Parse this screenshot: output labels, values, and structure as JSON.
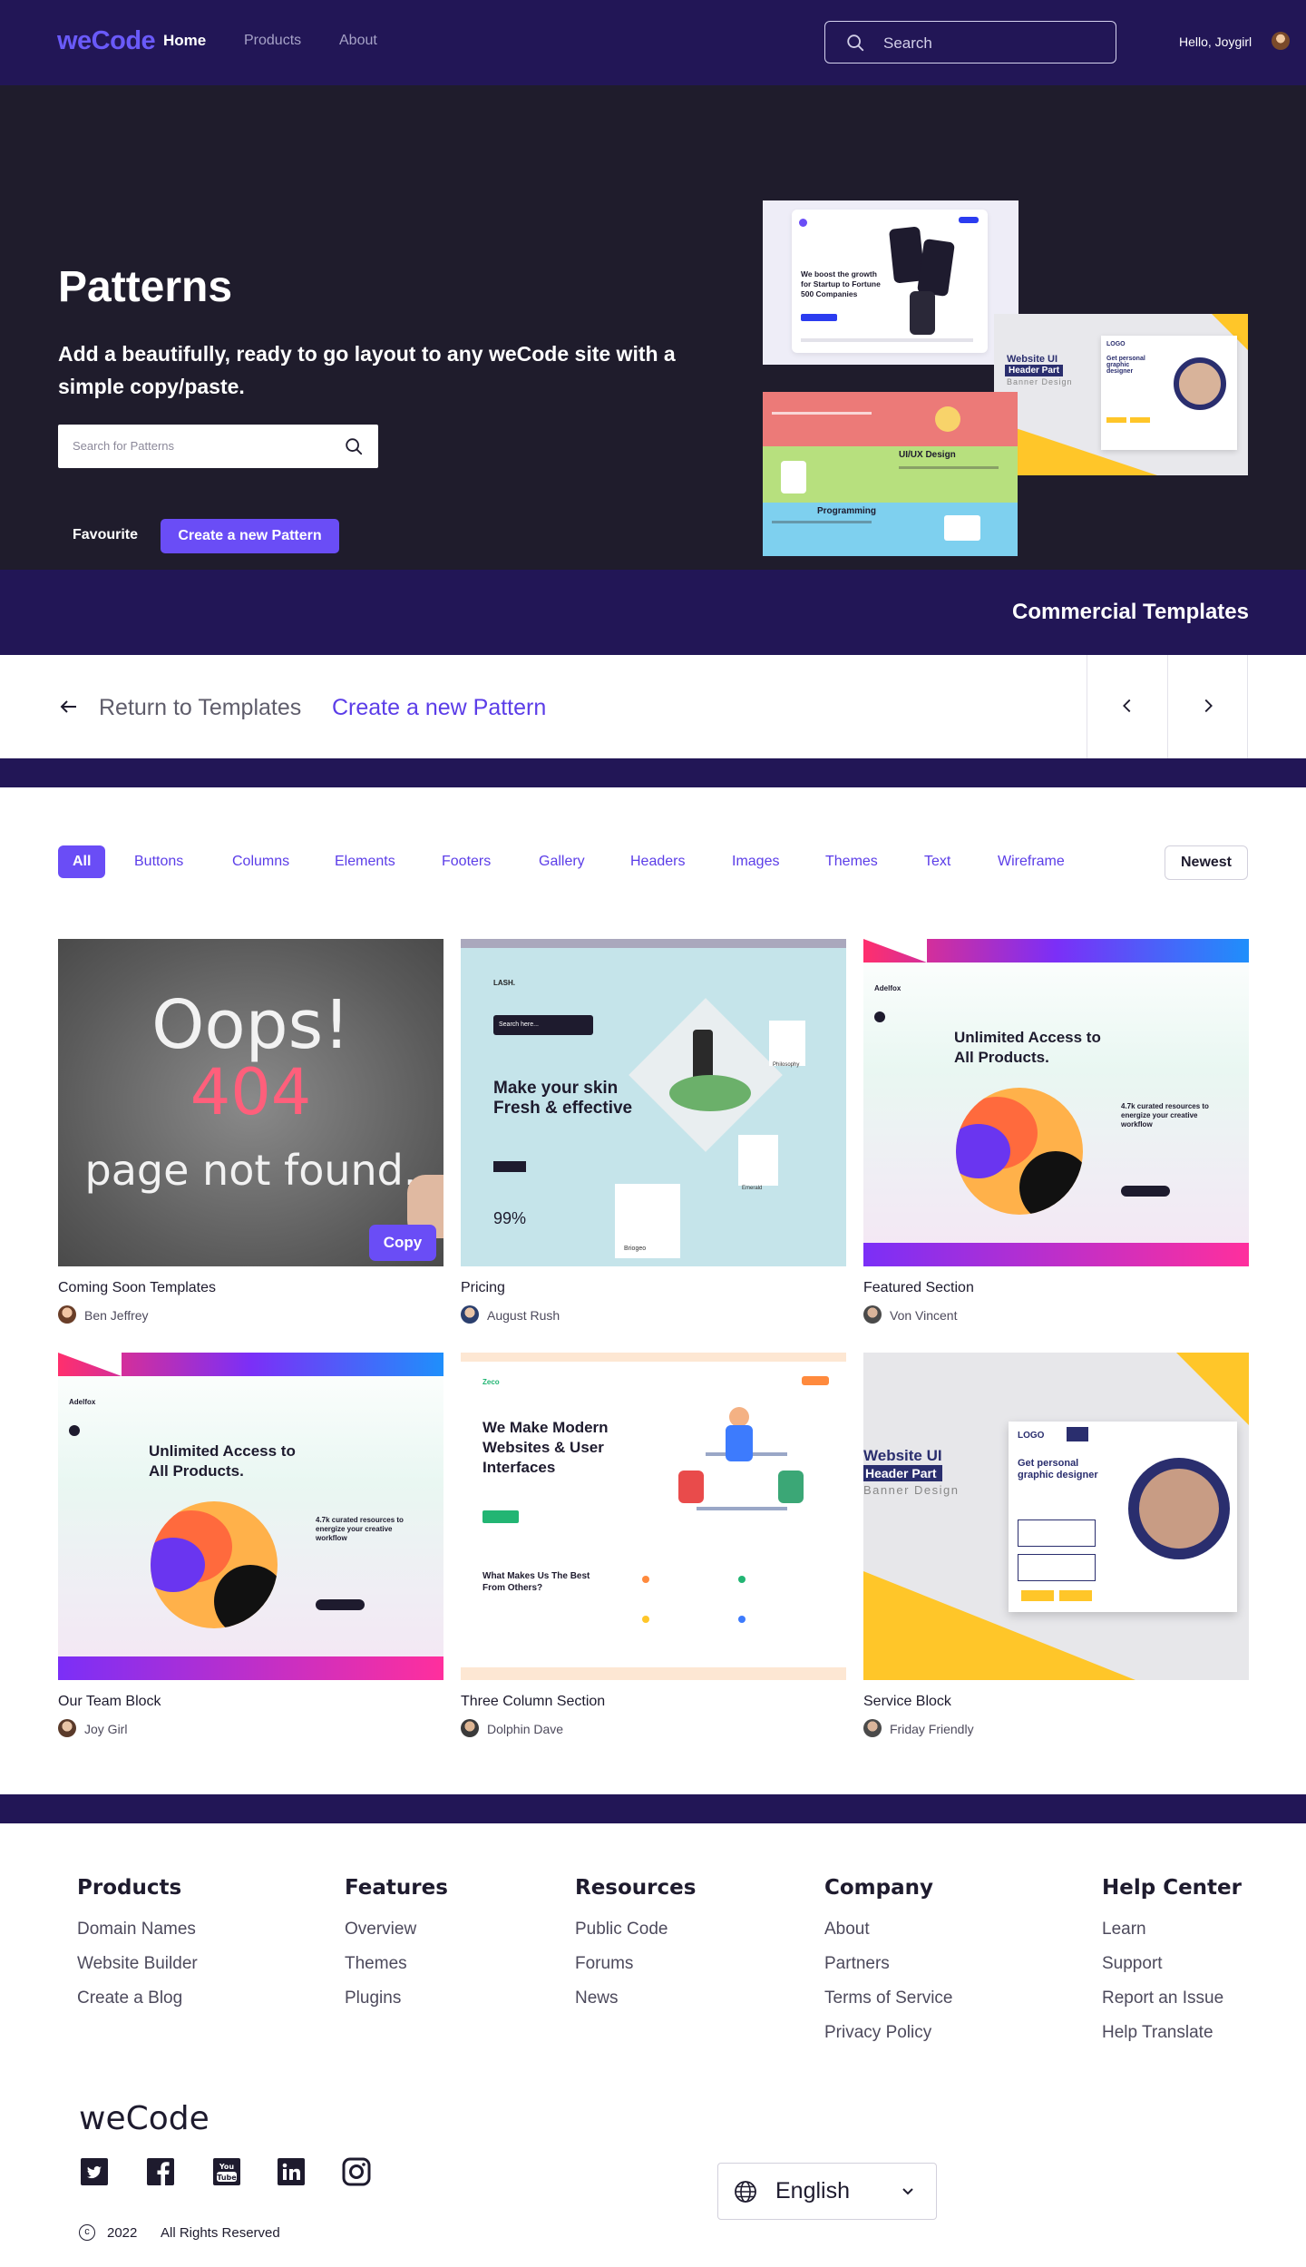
{
  "navbar": {
    "logo": "weCode",
    "links": [
      "Home",
      "Products",
      "About"
    ],
    "search_placeholder": "Search",
    "greeting": "Hello,  Joygirl"
  },
  "hero": {
    "title": "Patterns",
    "subtitle": "Add a beautifully, ready to go layout to any weCode site with a simple copy/paste.",
    "search_placeholder": "Search for Patterns",
    "favourite_label": "Favourite",
    "create_label": "Create a new Pattern",
    "preview": {
      "startup_headline": "We boost the growth for Startup to Fortune 500 Companies",
      "banner_title": "Website UI",
      "banner_highlight": "Header Part",
      "banner_sub": "Banner Design",
      "ux_title": "UI/UX Design",
      "programming_title": "Programming",
      "logo_text": "LOGO",
      "designer_text": "Get personal graphic designer"
    }
  },
  "commercial": {
    "label": "Commercial Templates"
  },
  "template_nav": {
    "return_label": "Return to Templates",
    "create_label": "Create a new Pattern"
  },
  "filters": {
    "items": [
      "All",
      "Buttons",
      "Columns",
      "Elements",
      "Footers",
      "Gallery",
      "Headers",
      "Images",
      "Themes",
      "Text",
      "Wireframe"
    ],
    "sort_label": "Newest"
  },
  "cards": [
    {
      "title": "Coming Soon Templates",
      "author": "Ben Jeffrey",
      "copy_label": "Copy",
      "thumb_texts": {
        "line1": "Oops!",
        "line2": "404",
        "line3": "page not found."
      }
    },
    {
      "title": "Pricing",
      "author": "August Rush",
      "thumb_texts": {
        "brand": "LASH.",
        "headline": "Make your skin Fresh & effective",
        "stat": "99%",
        "label_a": "Philosophy",
        "label_b": "Emerald",
        "label_c": "Briogeo",
        "search": "Search here..."
      }
    },
    {
      "title": "Featured Section",
      "author": "Von Vincent",
      "thumb_texts": {
        "brand": "Adelfox",
        "headline": "Unlimited Access to All Products.",
        "side": "4.7k curated resources to energize your creative workflow"
      }
    },
    {
      "title": "Our Team Block",
      "author": "Joy Girl",
      "thumb_texts": {
        "brand": "Adelfox",
        "headline": "Unlimited Access to All Products.",
        "side": "4.7k curated resources to energize your creative workflow"
      }
    },
    {
      "title": "Three Column Section",
      "author": "Dolphin Dave",
      "thumb_texts": {
        "brand": "Zeco",
        "headline": "We Make Modern Websites & User Interfaces",
        "sub": "What Makes Us The Best From Others?"
      }
    },
    {
      "title": "Service Block",
      "author": "Friday Friendly",
      "thumb_texts": {
        "banner_title": "Website UI",
        "banner_highlight": "Header Part",
        "banner_sub": "Banner Design",
        "logo": "LOGO",
        "designer": "Get personal graphic designer"
      }
    }
  ],
  "footer": {
    "columns": [
      {
        "heading": "Products",
        "links": [
          "Domain Names",
          "Website Builder",
          "Create a Blog"
        ]
      },
      {
        "heading": "Features",
        "links": [
          "Overview",
          "Themes",
          "Plugins"
        ]
      },
      {
        "heading": "Resources",
        "links": [
          "Public Code",
          "Forums",
          "News"
        ]
      },
      {
        "heading": "Company",
        "links": [
          "About",
          "Partners",
          "Terms of Service",
          "Privacy Policy"
        ]
      },
      {
        "heading": "Help Center",
        "links": [
          "Learn",
          "Support",
          "Report an Issue",
          "Help Translate"
        ]
      }
    ],
    "logo": "weCode",
    "social_icons": [
      "twitter-icon",
      "facebook-icon",
      "youtube-icon",
      "linkedin-icon",
      "instagram-icon"
    ],
    "language": "English",
    "year": "2022",
    "rights": "All Rights Reserved"
  },
  "colors": {
    "navy": "#221656",
    "hero_bg": "#1f1c2c",
    "accent": "#6a4df6",
    "link": "#5b3de8"
  }
}
